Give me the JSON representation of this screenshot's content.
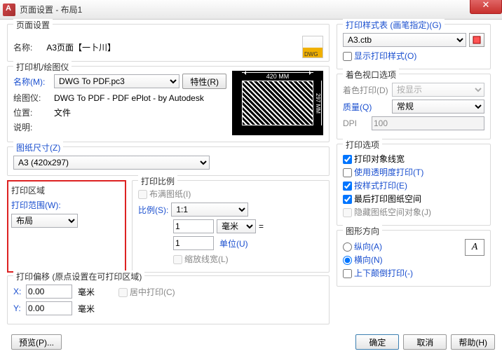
{
  "window": {
    "title": "页面设置 - 布局1"
  },
  "pageSetup": {
    "group": "页面设置",
    "name_lbl": "名称:",
    "name_val": "A3页面【一卜川】"
  },
  "printer": {
    "group": "打印机/绘图仪",
    "name_lbl": "名称(M):",
    "name_sel": "DWG To PDF.pc3",
    "props_btn": "特性(R)",
    "plotter_lbl": "绘图仪:",
    "plotter_val": "DWG To PDF - PDF ePlot - by Autodesk",
    "where_lbl": "位置:",
    "where_val": "文件",
    "desc_lbl": "说明:",
    "preview_w": "420 MM",
    "preview_h": "297 MM"
  },
  "paperSize": {
    "group": "图纸尺寸(Z)",
    "sel": "A3 (420x297)"
  },
  "plotArea": {
    "group": "打印区域",
    "range_lbl": "打印范围(W):",
    "sel": "布局"
  },
  "plotScale": {
    "group": "打印比例",
    "fit_lbl": "布满图纸(I)",
    "scale_lbl": "比例(S):",
    "scale_sel": "1:1",
    "unit1_val": "1",
    "unit1_sel": "毫米",
    "eq": "=",
    "unit2_val": "1",
    "unit2_lbl": "单位(U)",
    "scalelw_lbl": "缩放线宽(L)"
  },
  "offset": {
    "group": "打印偏移 (原点设置在可打印区域)",
    "x_lbl": "X:",
    "x_val": "0.00",
    "x_unit": "毫米",
    "y_lbl": "Y:",
    "y_val": "0.00",
    "y_unit": "毫米",
    "center_lbl": "居中打印(C)"
  },
  "styleTable": {
    "group": "打印样式表 (画笔指定)(G)",
    "sel": "A3.ctb",
    "display_lbl": "显示打印样式(O)"
  },
  "shaded": {
    "group": "着色视口选项",
    "shade_lbl": "着色打印(D)",
    "shade_sel": "按显示",
    "quality_lbl": "质量(Q)",
    "quality_sel": "常规",
    "dpi_lbl": "DPI",
    "dpi_val": "100"
  },
  "options": {
    "group": "打印选项",
    "o1": "打印对象线宽",
    "o2": "使用透明度打印(T)",
    "o3": "按样式打印(E)",
    "o4": "最后打印图纸空间",
    "o5": "隐藏图纸空间对象(J)"
  },
  "orient": {
    "group": "图形方向",
    "portrait": "纵向(A)",
    "landscape": "横向(N)",
    "upside": "上下颠倒打印(-)"
  },
  "footer": {
    "preview": "预览(P)...",
    "ok": "确定",
    "cancel": "取消",
    "help": "帮助(H)"
  }
}
